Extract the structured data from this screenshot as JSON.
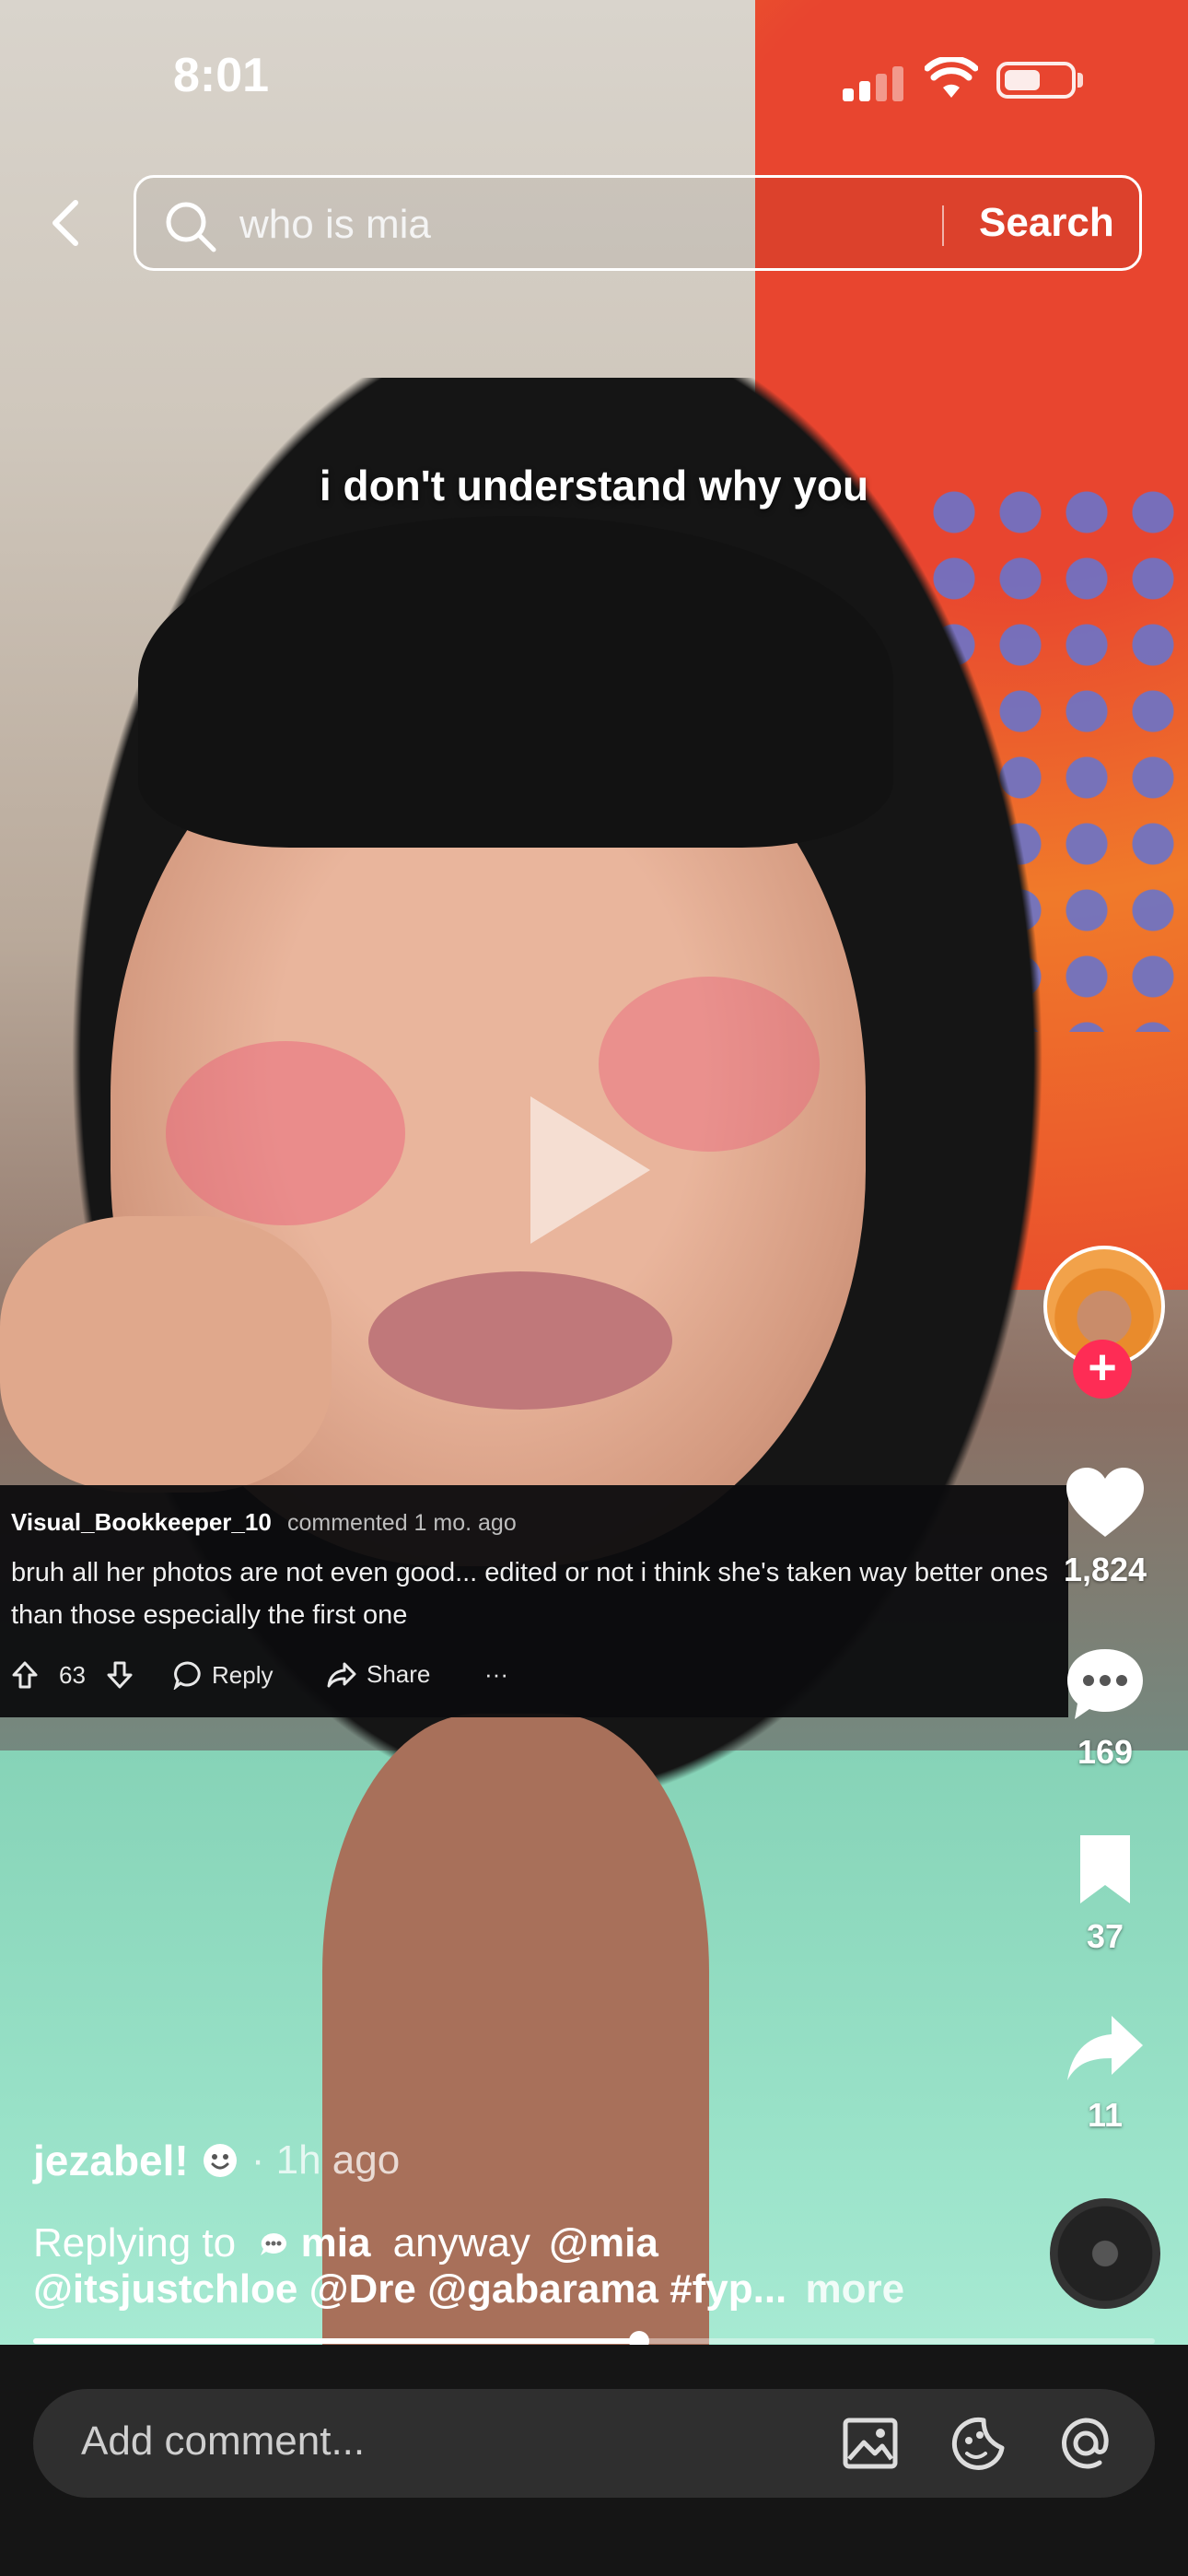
{
  "status_bar": {
    "time": "8:01"
  },
  "search": {
    "query": "who is mia",
    "button_label": "Search"
  },
  "video": {
    "caption": "i don't understand why you"
  },
  "comment_overlay": {
    "username": "Visual_Bookkeeper_10",
    "meta": "commented 1 mo. ago",
    "body": "bruh all her photos are not even good... edited or not i think she's taken way better ones than those especially the first one",
    "upvotes": "63",
    "reply_label": "Reply",
    "share_label": "Share",
    "more_label": "···"
  },
  "rail": {
    "likes": "1,824",
    "comments": "169",
    "saves": "37",
    "shares": "11"
  },
  "post": {
    "author": "jezabel!",
    "time": "· 1h ago",
    "replying_label": "Replying to",
    "replying_user": "mia",
    "text_word": "anyway",
    "mention_1": "@mia",
    "line2": "@itsjustchloe @Dre @gabarama #fyp...",
    "more_label": "more",
    "progress": 0.54
  },
  "comment_input": {
    "placeholder": "Add comment..."
  },
  "colors": {
    "accent": "#fe2c55",
    "background": "#151515"
  }
}
